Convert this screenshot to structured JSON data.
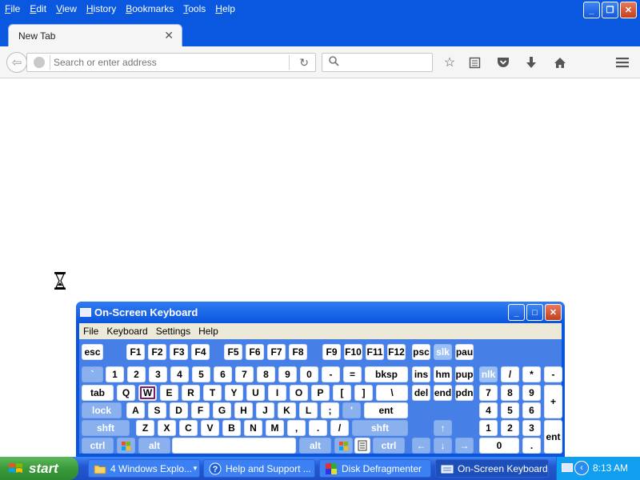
{
  "firefox": {
    "menu": [
      "File",
      "Edit",
      "View",
      "History",
      "Bookmarks",
      "Tools",
      "Help"
    ],
    "tab_title": "New Tab",
    "tab_close": "✕",
    "url_placeholder": "Search or enter address",
    "window_controls": {
      "minimize": "_",
      "maximize": "❐",
      "close": "✕"
    }
  },
  "osk": {
    "title": "On-Screen Keyboard",
    "menu": [
      "File",
      "Keyboard",
      "Settings",
      "Help"
    ],
    "controls": {
      "minimize": "_",
      "maximize": "□",
      "close": "✕"
    },
    "pressed_key": "W",
    "keys": [
      [
        "esc",
        "F1",
        "F2",
        "F3",
        "F4",
        "F5",
        "F6",
        "F7",
        "F8",
        "F9",
        "F10",
        "F11",
        "F12",
        "psc",
        "slk",
        "pau"
      ],
      [
        "`",
        "1",
        "2",
        "3",
        "4",
        "5",
        "6",
        "7",
        "8",
        "9",
        "0",
        "-",
        "=",
        "bksp",
        "ins",
        "hm",
        "pup",
        "nlk",
        "/",
        "*",
        "-"
      ],
      [
        "tab",
        "Q",
        "W",
        "E",
        "R",
        "T",
        "Y",
        "U",
        "I",
        "O",
        "P",
        "[",
        "]",
        "\\",
        "del",
        "end",
        "pdn",
        "7",
        "8",
        "9",
        "+"
      ],
      [
        "lock",
        "A",
        "S",
        "D",
        "F",
        "G",
        "H",
        "J",
        "K",
        "L",
        ";",
        "'",
        "ent",
        "4",
        "5",
        "6"
      ],
      [
        "shft",
        "Z",
        "X",
        "C",
        "V",
        "B",
        "N",
        "M",
        ",",
        ".",
        "/",
        "shft",
        "↑",
        "1",
        "2",
        "3",
        "ent"
      ],
      [
        "ctrl",
        "alt",
        "alt",
        "ctrl",
        "←",
        "↓",
        "→",
        "0",
        "."
      ]
    ]
  },
  "taskbar": {
    "start_label": "start",
    "tasks": [
      {
        "label": "4 Windows Explo...",
        "has_arrow": true
      },
      {
        "label": "Help and Support ..."
      },
      {
        "label": "Disk Defragmenter"
      },
      {
        "label": "On-Screen Keyboard",
        "active": true
      }
    ],
    "clock": "8:13 AM"
  },
  "colors": {
    "titlebar_blue": "#0a58e0",
    "osk_blue": "#0a55dd",
    "key_white": "#ffffff",
    "mod_key": "#8ab0ee",
    "start_green": "#3a9a3a",
    "pressed_outline": "#7a1e6b"
  }
}
